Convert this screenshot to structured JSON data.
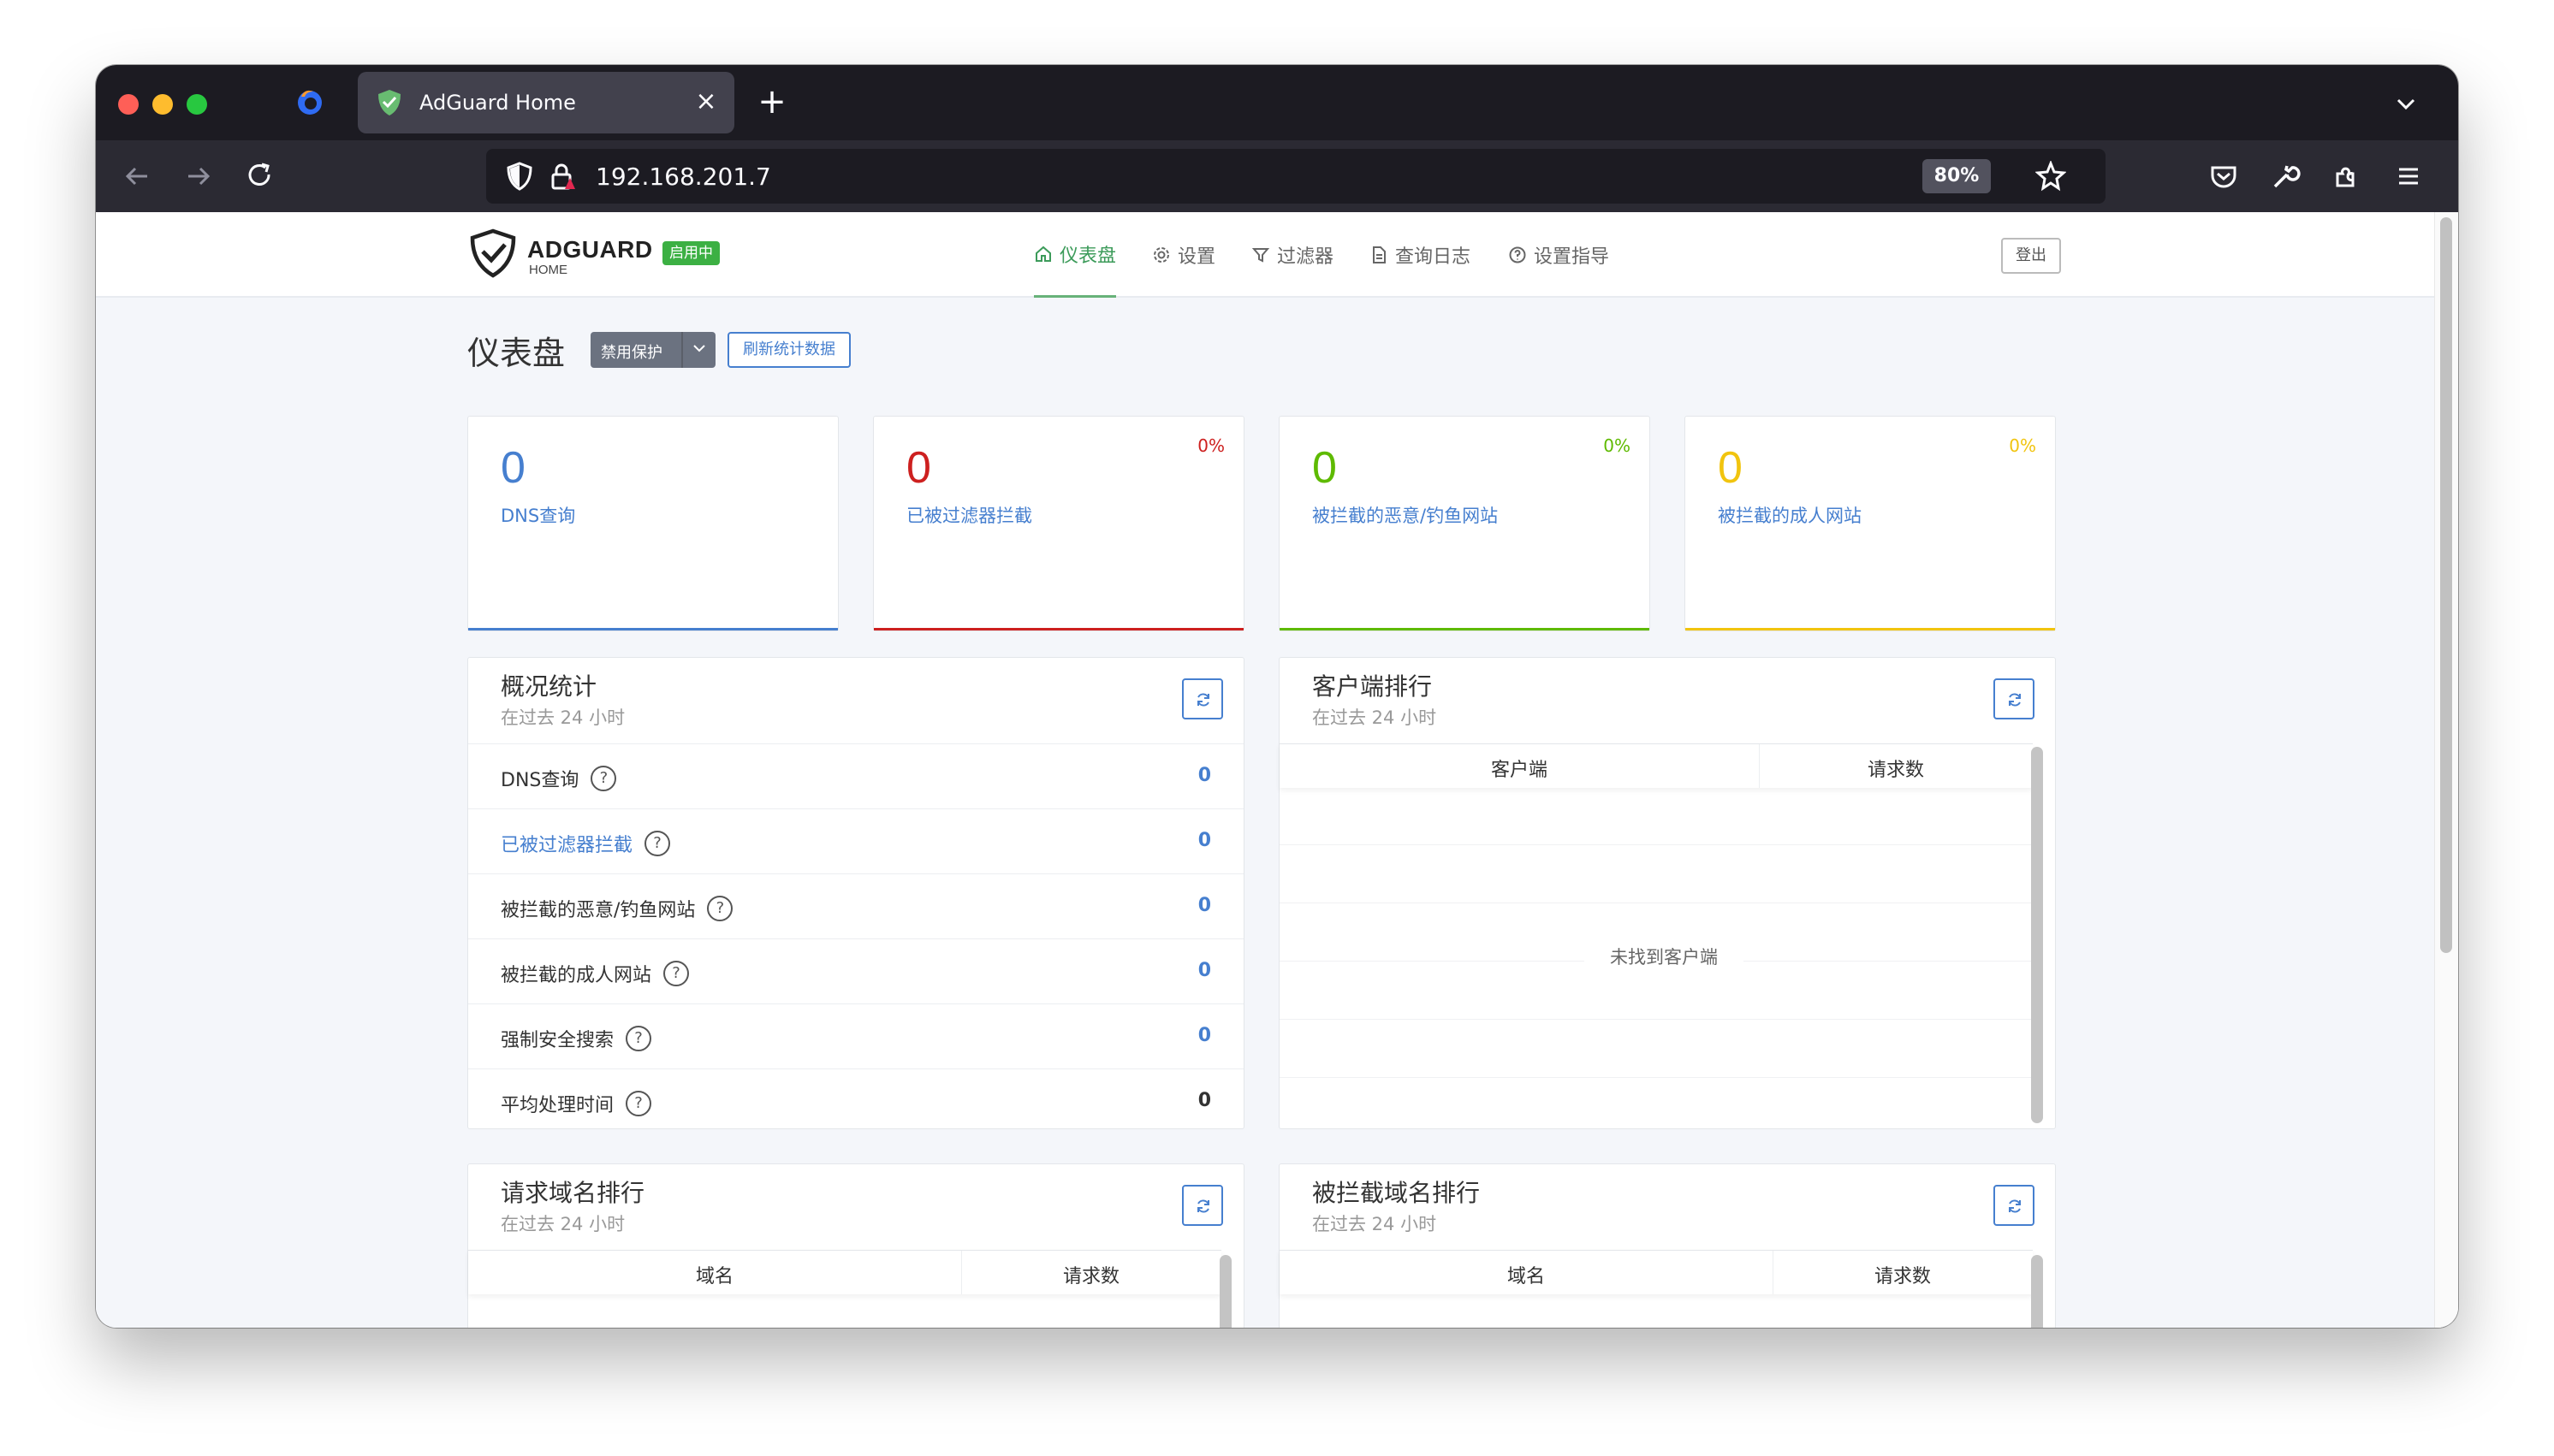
{
  "browser": {
    "tab_title": "AdGuard Home",
    "url": "192.168.201.7",
    "zoom": "80%"
  },
  "app": {
    "brand": "ADGUARD",
    "brand_sub": "HOME",
    "status_badge": "启用中",
    "nav": [
      {
        "label": "仪表盘",
        "icon": "home-icon",
        "active": true
      },
      {
        "label": "设置",
        "icon": "gear-icon",
        "active": false
      },
      {
        "label": "过滤器",
        "icon": "filter-icon",
        "active": false
      },
      {
        "label": "查询日志",
        "icon": "document-icon",
        "active": false
      },
      {
        "label": "设置指导",
        "icon": "help-circle-icon",
        "active": false
      }
    ],
    "logout": "登出"
  },
  "dashboard": {
    "title": "仪表盘",
    "disable_protection": "禁用保护",
    "refresh_stats": "刷新统计数据"
  },
  "cards": [
    {
      "value": "0",
      "label": "DNS查询",
      "percent": "",
      "color": "#467fcf"
    },
    {
      "value": "0",
      "label": "已被过滤器拦截",
      "percent": "0%",
      "color": "#cd201f"
    },
    {
      "value": "0",
      "label": "被拦截的恶意/钓鱼网站",
      "percent": "0%",
      "color": "#5eba00"
    },
    {
      "value": "0",
      "label": "被拦截的成人网站",
      "percent": "0%",
      "color": "#f1c40f"
    }
  ],
  "overview": {
    "title": "概况统计",
    "subtitle": "在过去 24 小时",
    "rows": [
      {
        "label": "DNS查询",
        "value": "0",
        "value_color": "#467fcf"
      },
      {
        "label": "已被过滤器拦截",
        "value": "0",
        "value_color": "#467fcf"
      },
      {
        "label": "被拦截的恶意/钓鱼网站",
        "value": "0",
        "value_color": "#467fcf"
      },
      {
        "label": "被拦截的成人网站",
        "value": "0",
        "value_color": "#467fcf"
      },
      {
        "label": "强制安全搜索",
        "value": "0",
        "value_color": "#467fcf"
      },
      {
        "label": "平均处理时间",
        "value": "0",
        "value_color": "#333333"
      }
    ]
  },
  "top_clients": {
    "title": "客户端排行",
    "subtitle": "在过去 24 小时",
    "col_client": "客户端",
    "col_requests": "请求数",
    "empty": "未找到客户端"
  },
  "top_queried": {
    "title": "请求域名排行",
    "subtitle": "在过去 24 小时",
    "col_domain": "域名",
    "col_requests": "请求数"
  },
  "top_blocked": {
    "title": "被拦截域名排行",
    "subtitle": "在过去 24 小时",
    "col_domain": "域名",
    "col_requests": "请求数"
  }
}
